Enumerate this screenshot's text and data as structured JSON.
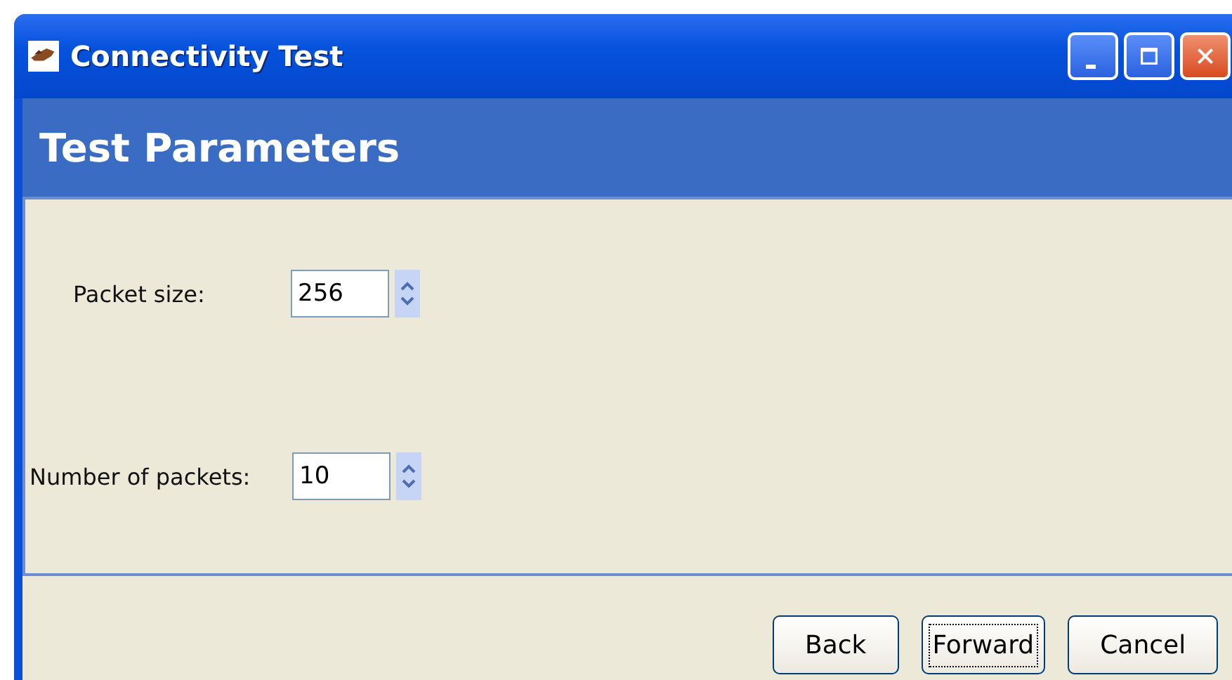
{
  "window": {
    "title": "Connectivity Test"
  },
  "header": {
    "title": "Test Parameters"
  },
  "fields": [
    {
      "label": "Packet size:",
      "value": "256"
    },
    {
      "label": "Number of packets:",
      "value": "10"
    }
  ],
  "buttons": [
    {
      "label": "Back",
      "focused": false
    },
    {
      "label": "Forward",
      "focused": true
    },
    {
      "label": "Cancel",
      "focused": false
    }
  ]
}
